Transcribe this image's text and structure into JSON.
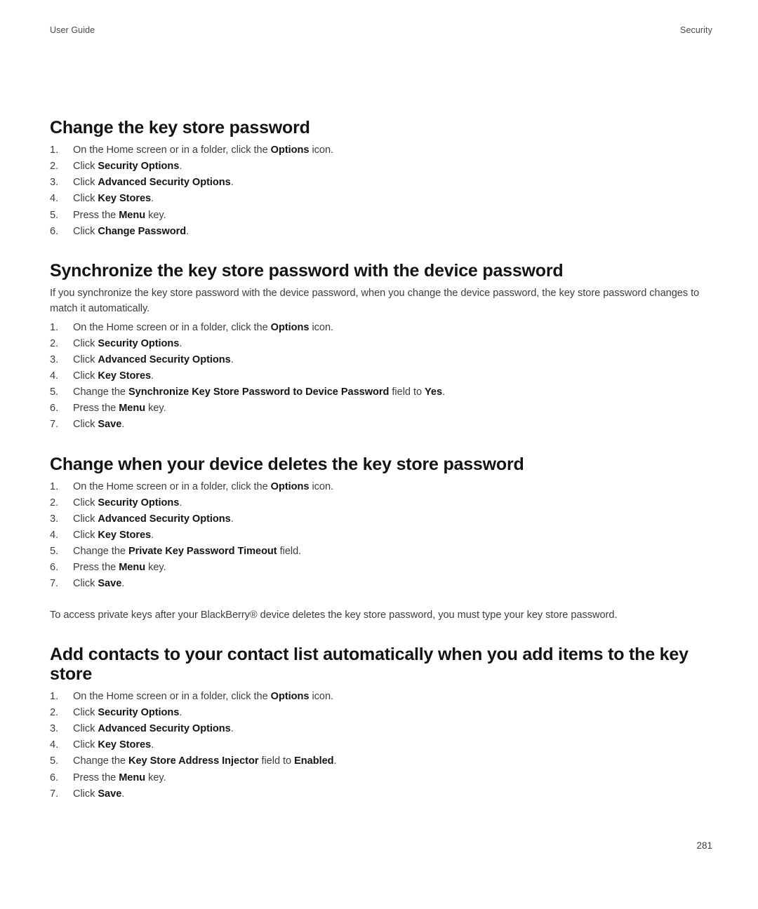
{
  "header": {
    "left": "User Guide",
    "right": "Security"
  },
  "footer": {
    "page_number": "281"
  },
  "sections": [
    {
      "heading": "Change the key store password",
      "intro": null,
      "steps": [
        [
          {
            "t": "On the Home screen or in a folder, click the ",
            "b": false
          },
          {
            "t": "Options",
            "b": true
          },
          {
            "t": " icon.",
            "b": false
          }
        ],
        [
          {
            "t": "Click ",
            "b": false
          },
          {
            "t": "Security Options",
            "b": true
          },
          {
            "t": ".",
            "b": false
          }
        ],
        [
          {
            "t": "Click ",
            "b": false
          },
          {
            "t": "Advanced Security Options",
            "b": true
          },
          {
            "t": ".",
            "b": false
          }
        ],
        [
          {
            "t": "Click ",
            "b": false
          },
          {
            "t": "Key Stores",
            "b": true
          },
          {
            "t": ".",
            "b": false
          }
        ],
        [
          {
            "t": "Press the ",
            "b": false
          },
          {
            "t": "Menu",
            "b": true
          },
          {
            "t": " key.",
            "b": false
          }
        ],
        [
          {
            "t": "Click ",
            "b": false
          },
          {
            "t": "Change Password",
            "b": true
          },
          {
            "t": ".",
            "b": false
          }
        ]
      ],
      "outro": null
    },
    {
      "heading": "Synchronize the key store password with the device password",
      "intro": "If you synchronize the key store password with the device password, when you change the device password, the key store password changes to match it automatically.",
      "steps": [
        [
          {
            "t": "On the Home screen or in a folder, click the ",
            "b": false
          },
          {
            "t": "Options",
            "b": true
          },
          {
            "t": " icon.",
            "b": false
          }
        ],
        [
          {
            "t": "Click ",
            "b": false
          },
          {
            "t": "Security Options",
            "b": true
          },
          {
            "t": ".",
            "b": false
          }
        ],
        [
          {
            "t": "Click ",
            "b": false
          },
          {
            "t": "Advanced Security Options",
            "b": true
          },
          {
            "t": ".",
            "b": false
          }
        ],
        [
          {
            "t": "Click ",
            "b": false
          },
          {
            "t": "Key Stores",
            "b": true
          },
          {
            "t": ".",
            "b": false
          }
        ],
        [
          {
            "t": "Change the ",
            "b": false
          },
          {
            "t": "Synchronize Key Store Password to Device Password",
            "b": true
          },
          {
            "t": " field to ",
            "b": false
          },
          {
            "t": "Yes",
            "b": true
          },
          {
            "t": ".",
            "b": false
          }
        ],
        [
          {
            "t": "Press the ",
            "b": false
          },
          {
            "t": "Menu",
            "b": true
          },
          {
            "t": " key.",
            "b": false
          }
        ],
        [
          {
            "t": "Click ",
            "b": false
          },
          {
            "t": "Save",
            "b": true
          },
          {
            "t": ".",
            "b": false
          }
        ]
      ],
      "outro": null
    },
    {
      "heading": "Change when your device deletes the key store password",
      "intro": null,
      "steps": [
        [
          {
            "t": "On the Home screen or in a folder, click the ",
            "b": false
          },
          {
            "t": "Options",
            "b": true
          },
          {
            "t": " icon.",
            "b": false
          }
        ],
        [
          {
            "t": "Click ",
            "b": false
          },
          {
            "t": "Security Options",
            "b": true
          },
          {
            "t": ".",
            "b": false
          }
        ],
        [
          {
            "t": "Click ",
            "b": false
          },
          {
            "t": "Advanced Security Options",
            "b": true
          },
          {
            "t": ".",
            "b": false
          }
        ],
        [
          {
            "t": "Click ",
            "b": false
          },
          {
            "t": "Key Stores",
            "b": true
          },
          {
            "t": ".",
            "b": false
          }
        ],
        [
          {
            "t": "Change the ",
            "b": false
          },
          {
            "t": "Private Key Password Timeout",
            "b": true
          },
          {
            "t": " field.",
            "b": false
          }
        ],
        [
          {
            "t": "Press the ",
            "b": false
          },
          {
            "t": "Menu",
            "b": true
          },
          {
            "t": " key.",
            "b": false
          }
        ],
        [
          {
            "t": "Click ",
            "b": false
          },
          {
            "t": "Save",
            "b": true
          },
          {
            "t": ".",
            "b": false
          }
        ]
      ],
      "outro": "To access private keys after your BlackBerry® device deletes the key store password, you must type your key store password."
    },
    {
      "heading": "Add contacts to your contact list automatically when you add items to the key store",
      "intro": null,
      "steps": [
        [
          {
            "t": "On the Home screen or in a folder, click the ",
            "b": false
          },
          {
            "t": "Options",
            "b": true
          },
          {
            "t": " icon.",
            "b": false
          }
        ],
        [
          {
            "t": "Click ",
            "b": false
          },
          {
            "t": "Security Options",
            "b": true
          },
          {
            "t": ".",
            "b": false
          }
        ],
        [
          {
            "t": "Click ",
            "b": false
          },
          {
            "t": "Advanced Security Options",
            "b": true
          },
          {
            "t": ".",
            "b": false
          }
        ],
        [
          {
            "t": "Click ",
            "b": false
          },
          {
            "t": "Key Stores",
            "b": true
          },
          {
            "t": ".",
            "b": false
          }
        ],
        [
          {
            "t": "Change the ",
            "b": false
          },
          {
            "t": "Key Store Address Injector",
            "b": true
          },
          {
            "t": " field to ",
            "b": false
          },
          {
            "t": "Enabled",
            "b": true
          },
          {
            "t": ".",
            "b": false
          }
        ],
        [
          {
            "t": "Press the ",
            "b": false
          },
          {
            "t": "Menu",
            "b": true
          },
          {
            "t": " key.",
            "b": false
          }
        ],
        [
          {
            "t": "Click ",
            "b": false
          },
          {
            "t": "Save",
            "b": true
          },
          {
            "t": ".",
            "b": false
          }
        ]
      ],
      "outro": null
    }
  ]
}
